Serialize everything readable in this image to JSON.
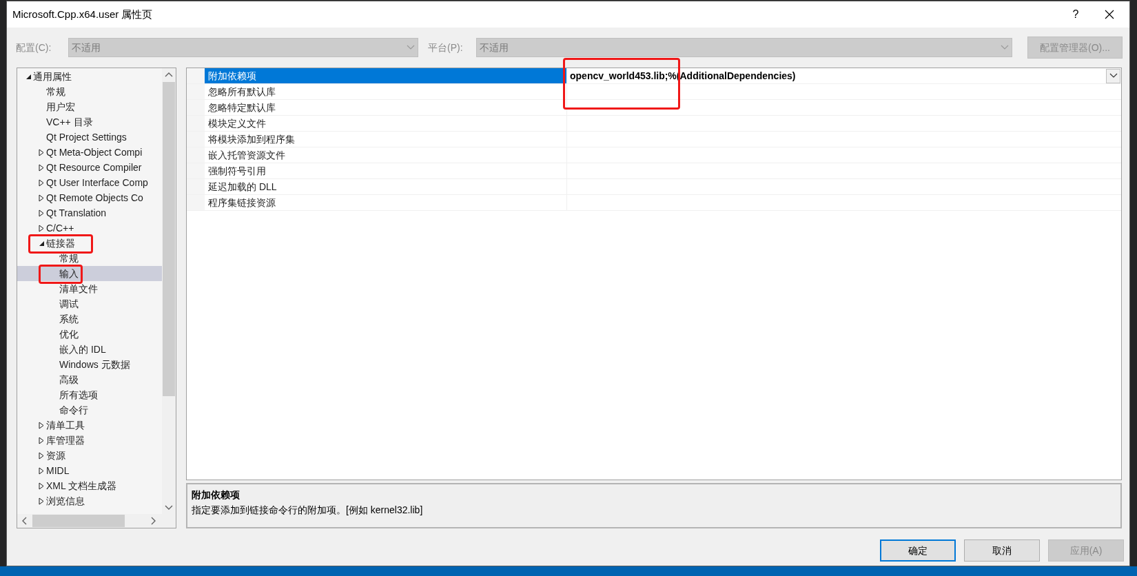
{
  "window": {
    "title": "Microsoft.Cpp.x64.user 属性页",
    "help": "?"
  },
  "config_bar": {
    "config_label": "配置(C):",
    "config_value": "不适用",
    "platform_label": "平台(P):",
    "platform_value": "不适用",
    "manager_button": {
      "label": "配置管理器(O)...",
      "disabled": true
    }
  },
  "tree": [
    {
      "label": "通用属性",
      "kind": "group",
      "expanded": true,
      "selected": false,
      "highlighted": false,
      "children": [
        {
          "label": "常规",
          "kind": "leaf",
          "selected": false,
          "highlighted": false
        },
        {
          "label": "用户宏",
          "kind": "leaf",
          "selected": false,
          "highlighted": false
        },
        {
          "label": "VC++ 目录",
          "kind": "leaf",
          "selected": false,
          "highlighted": false
        },
        {
          "label": "Qt Project Settings",
          "kind": "leaf",
          "selected": false,
          "highlighted": false
        },
        {
          "label": "Qt Meta-Object Compi",
          "kind": "group",
          "expanded": false,
          "selected": false,
          "highlighted": false
        },
        {
          "label": "Qt Resource Compiler",
          "kind": "group",
          "expanded": false,
          "selected": false,
          "highlighted": false
        },
        {
          "label": "Qt User Interface Comp",
          "kind": "group",
          "expanded": false,
          "selected": false,
          "highlighted": false
        },
        {
          "label": "Qt Remote Objects Co",
          "kind": "group",
          "expanded": false,
          "selected": false,
          "highlighted": false
        },
        {
          "label": "Qt Translation",
          "kind": "group",
          "expanded": false,
          "selected": false,
          "highlighted": false
        },
        {
          "label": "C/C++",
          "kind": "group",
          "expanded": false,
          "selected": false,
          "highlighted": false
        },
        {
          "label": "链接器",
          "kind": "group",
          "expanded": true,
          "selected": false,
          "highlighted": true,
          "children": [
            {
              "label": "常规",
              "kind": "leaf",
              "selected": false,
              "highlighted": false
            },
            {
              "label": "输入",
              "kind": "leaf",
              "selected": true,
              "highlighted": true
            },
            {
              "label": "清单文件",
              "kind": "leaf",
              "selected": false,
              "highlighted": false
            },
            {
              "label": "调试",
              "kind": "leaf",
              "selected": false,
              "highlighted": false
            },
            {
              "label": "系统",
              "kind": "leaf",
              "selected": false,
              "highlighted": false
            },
            {
              "label": "优化",
              "kind": "leaf",
              "selected": false,
              "highlighted": false
            },
            {
              "label": "嵌入的 IDL",
              "kind": "leaf",
              "selected": false,
              "highlighted": false
            },
            {
              "label": "Windows 元数据",
              "kind": "leaf",
              "selected": false,
              "highlighted": false
            },
            {
              "label": "高级",
              "kind": "leaf",
              "selected": false,
              "highlighted": false
            },
            {
              "label": "所有选项",
              "kind": "leaf",
              "selected": false,
              "highlighted": false
            },
            {
              "label": "命令行",
              "kind": "leaf",
              "selected": false,
              "highlighted": false
            }
          ]
        },
        {
          "label": "清单工具",
          "kind": "group",
          "expanded": false,
          "selected": false,
          "highlighted": false
        },
        {
          "label": "库管理器",
          "kind": "group",
          "expanded": false,
          "selected": false,
          "highlighted": false
        },
        {
          "label": "资源",
          "kind": "group",
          "expanded": false,
          "selected": false,
          "highlighted": false
        },
        {
          "label": "MIDL",
          "kind": "group",
          "expanded": false,
          "selected": false,
          "highlighted": false
        },
        {
          "label": "XML 文档生成器",
          "kind": "group",
          "expanded": false,
          "selected": false,
          "highlighted": false
        },
        {
          "label": "浏览信息",
          "kind": "group",
          "expanded": false,
          "selected": false,
          "highlighted": false
        }
      ]
    }
  ],
  "properties": [
    {
      "name": "附加依赖项",
      "value": "opencv_world453.lib;%(AdditionalDependencies)",
      "selected": true,
      "highlighted": true
    },
    {
      "name": "忽略所有默认库",
      "selected": false,
      "highlighted": false
    },
    {
      "name": "忽略特定默认库",
      "selected": false,
      "highlighted": false
    },
    {
      "name": "模块定义文件",
      "selected": false,
      "highlighted": false
    },
    {
      "name": "将模块添加到程序集",
      "selected": false,
      "highlighted": false
    },
    {
      "name": "嵌入托管资源文件",
      "selected": false,
      "highlighted": false
    },
    {
      "name": "强制符号引用",
      "selected": false,
      "highlighted": false
    },
    {
      "name": "延迟加载的 DLL",
      "selected": false,
      "highlighted": false
    },
    {
      "name": "程序集链接资源",
      "selected": false,
      "highlighted": false
    }
  ],
  "description": {
    "title": "附加依赖项",
    "text": "指定要添加到链接命令行的附加项。[例如 kernel32.lib]"
  },
  "buttons": [
    {
      "label": "确定",
      "default": true,
      "disabled": false
    },
    {
      "label": "取消",
      "default": false,
      "disabled": false
    },
    {
      "label": "应用(A)",
      "default": false,
      "disabled": true
    }
  ]
}
